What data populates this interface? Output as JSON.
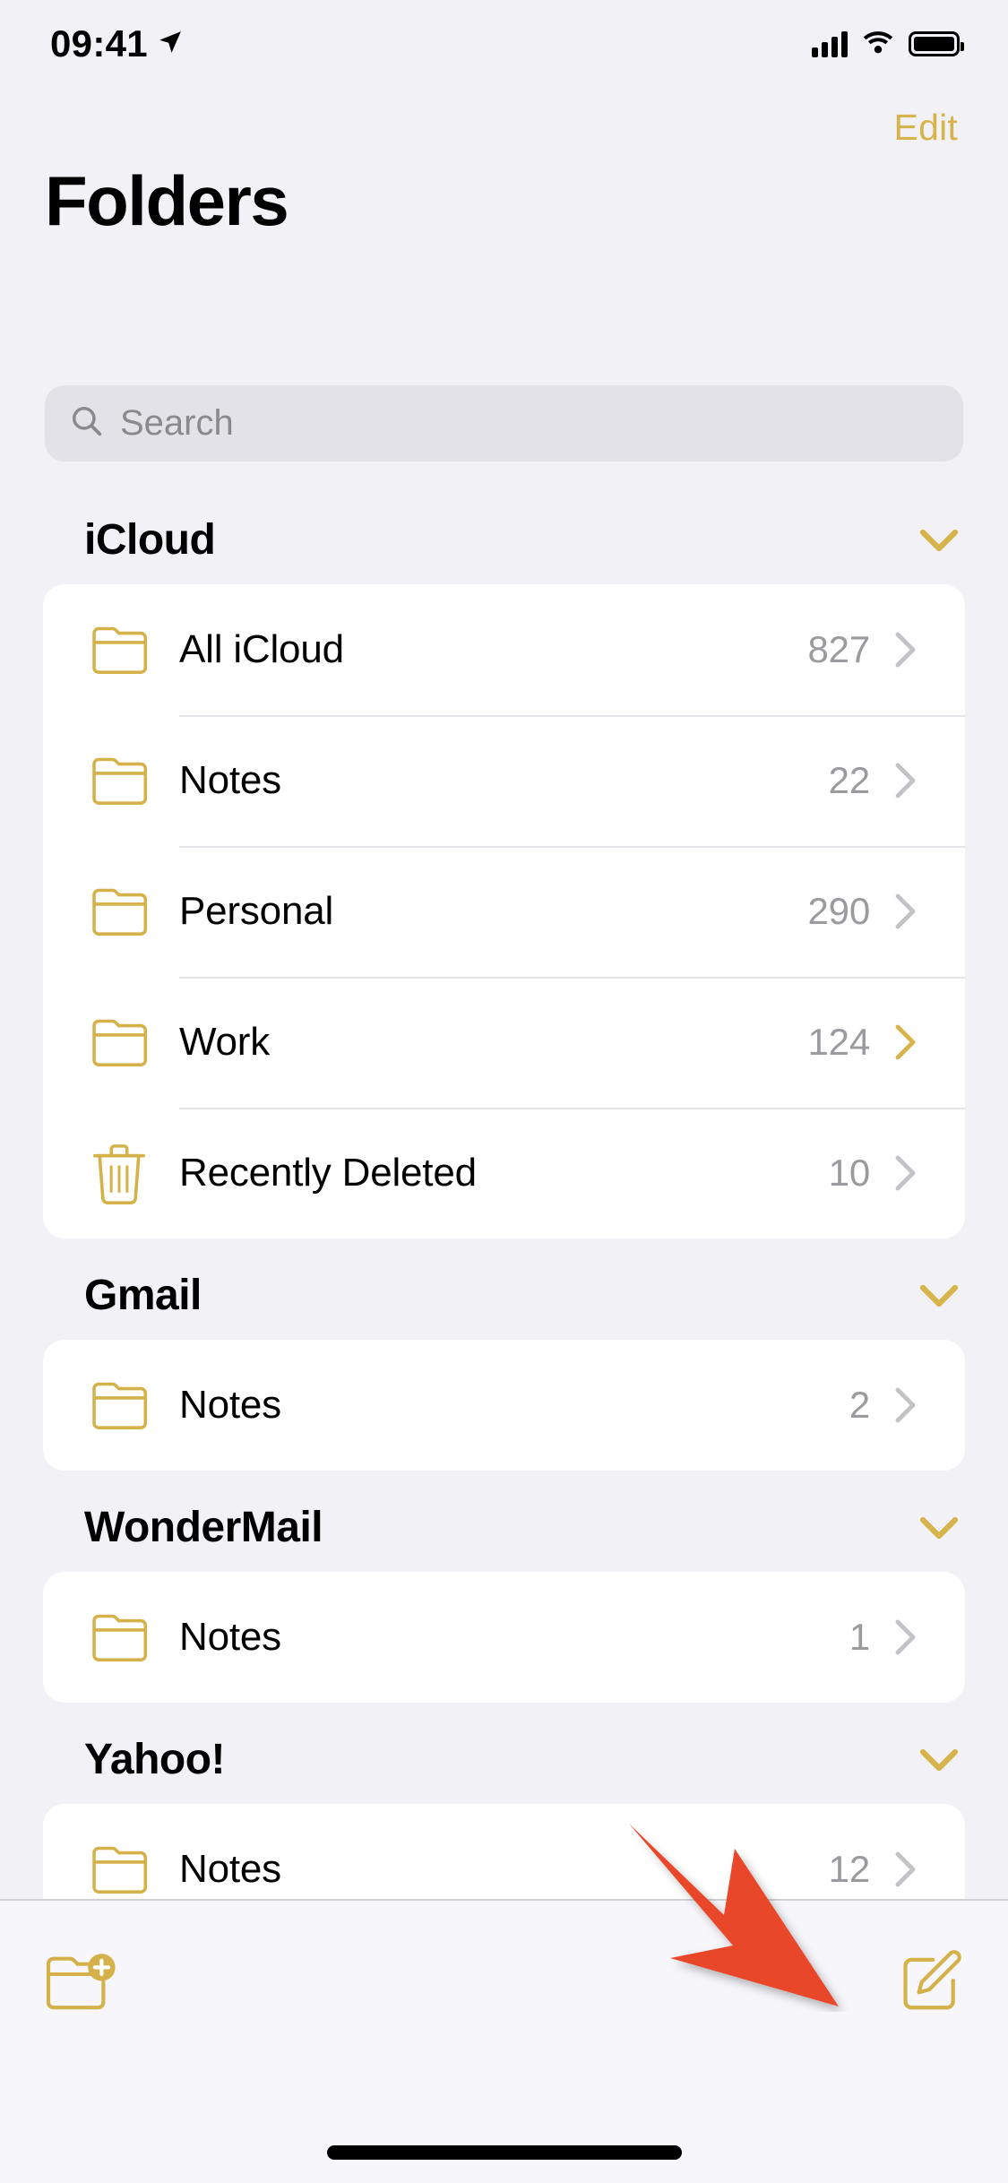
{
  "status_bar": {
    "time": "09:41",
    "location_icon": "location-arrow-icon",
    "signal_icon": "cellular-signal-icon",
    "wifi_icon": "wifi-icon",
    "battery_icon": "battery-full-icon"
  },
  "nav": {
    "edit_label": "Edit"
  },
  "header": {
    "title": "Folders"
  },
  "search": {
    "placeholder": "Search",
    "value": "",
    "icon": "search-icon"
  },
  "colors": {
    "accent_yellow": "#D6B44B",
    "folder_yellow": "#D5B14A",
    "background": "#F2F1F6",
    "card": "#FFFFFF",
    "secondary_text": "#9A9A9F",
    "annotation_red": "#E8462A"
  },
  "sections": [
    {
      "title": "iCloud",
      "chevron_icon": "chevron-down-icon",
      "rows": [
        {
          "icon": "folder-icon",
          "label": "All iCloud",
          "count": "827",
          "chevron_icon": "chevron-right-icon",
          "chevron_color": "gray"
        },
        {
          "icon": "folder-icon",
          "label": "Notes",
          "count": "22",
          "chevron_icon": "chevron-right-icon",
          "chevron_color": "gray"
        },
        {
          "icon": "folder-icon",
          "label": "Personal",
          "count": "290",
          "chevron_icon": "chevron-right-icon",
          "chevron_color": "gray"
        },
        {
          "icon": "folder-icon",
          "label": "Work",
          "count": "124",
          "chevron_icon": "chevron-right-icon",
          "chevron_color": "yellow"
        },
        {
          "icon": "trash-icon",
          "label": "Recently Deleted",
          "count": "10",
          "chevron_icon": "chevron-right-icon",
          "chevron_color": "gray"
        }
      ]
    },
    {
      "title": "Gmail",
      "chevron_icon": "chevron-down-icon",
      "rows": [
        {
          "icon": "folder-icon",
          "label": "Notes",
          "count": "2",
          "chevron_icon": "chevron-right-icon",
          "chevron_color": "gray"
        }
      ]
    },
    {
      "title": "WonderMail",
      "chevron_icon": "chevron-down-icon",
      "rows": [
        {
          "icon": "folder-icon",
          "label": "Notes",
          "count": "1",
          "chevron_icon": "chevron-right-icon",
          "chevron_color": "gray"
        }
      ]
    },
    {
      "title": "Yahoo!",
      "chevron_icon": "chevron-down-icon",
      "rows": [
        {
          "icon": "folder-icon",
          "label": "Notes",
          "count": "12",
          "chevron_icon": "chevron-right-icon",
          "chevron_color": "gray"
        }
      ]
    }
  ],
  "toolbar": {
    "new_folder_icon": "new-folder-icon",
    "compose_icon": "compose-note-icon"
  },
  "annotation": {
    "type": "arrow",
    "color": "#E8462A",
    "points_to": "compose-note-button"
  }
}
